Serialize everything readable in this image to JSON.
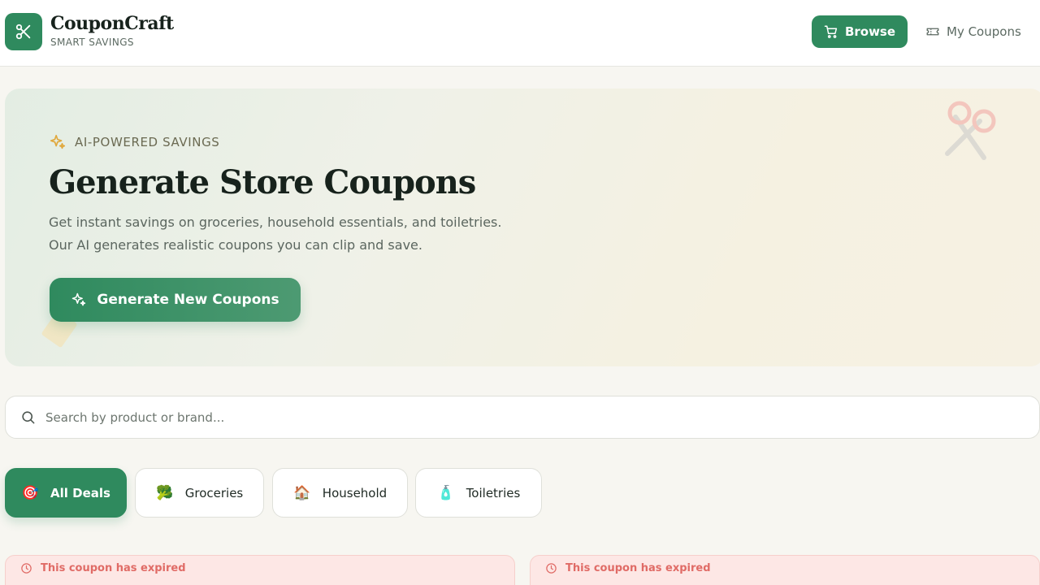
{
  "header": {
    "brand_name": "CouponCraft",
    "brand_sub": "SMART SAVINGS",
    "browse_label": "Browse",
    "my_coupons_label": "My Coupons"
  },
  "hero": {
    "tag": "AI-POWERED SAVINGS",
    "title": "Generate Store Coupons",
    "desc_line1": "Get instant savings on groceries, household essentials, and toiletries.",
    "desc_line2": "Our AI generates realistic coupons you can clip and save.",
    "generate_label": "Generate New Coupons"
  },
  "search": {
    "placeholder": "Search by product or brand...",
    "value": ""
  },
  "categories": [
    {
      "label": "All Deals",
      "icon": "target-icon",
      "emoji": "🎯",
      "active": true
    },
    {
      "label": "Groceries",
      "icon": "broccoli-icon",
      "emoji": "🥦",
      "active": false
    },
    {
      "label": "Household",
      "icon": "house-icon",
      "emoji": "🏠",
      "active": false
    },
    {
      "label": "Toiletries",
      "icon": "lotion-bottle-icon",
      "emoji": "🧴",
      "active": false
    }
  ],
  "cards": [
    {
      "status": "This coupon has expired"
    },
    {
      "status": "This coupon has expired"
    }
  ],
  "colors": {
    "accent": "#2f8a5e",
    "background": "#f7f6f1",
    "expired_bg": "#fde7e5",
    "expired_text": "#e06b66",
    "sparkle": "#e0a83c"
  }
}
